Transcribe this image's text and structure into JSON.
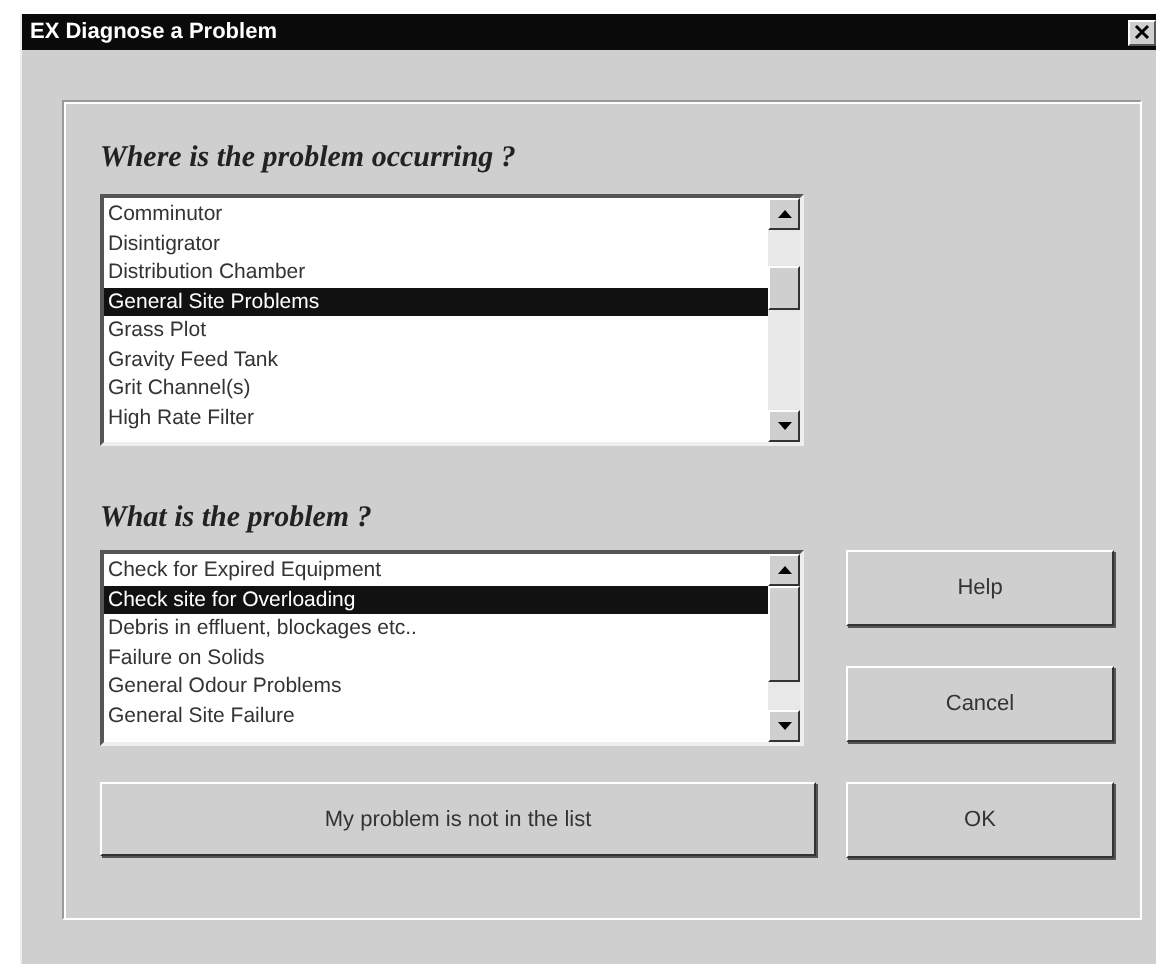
{
  "window": {
    "title": "EX Diagnose a Problem"
  },
  "location": {
    "heading": "Where is the problem occurring ?",
    "items": [
      {
        "label": "Comminutor",
        "selected": false
      },
      {
        "label": "Disintigrator",
        "selected": false
      },
      {
        "label": "Distribution Chamber",
        "selected": false
      },
      {
        "label": "General Site Problems",
        "selected": true
      },
      {
        "label": "Grass Plot",
        "selected": false
      },
      {
        "label": "Gravity Feed Tank",
        "selected": false
      },
      {
        "label": "Grit Channel(s)",
        "selected": false
      },
      {
        "label": "High Rate Filter",
        "selected": false
      }
    ]
  },
  "problem": {
    "heading": "What is the problem ?",
    "items": [
      {
        "label": "Check for Expired Equipment",
        "selected": false
      },
      {
        "label": "Check site for Overloading",
        "selected": true
      },
      {
        "label": "Debris in effluent, blockages etc..",
        "selected": false
      },
      {
        "label": "Failure on Solids",
        "selected": false
      },
      {
        "label": "General Odour Problems",
        "selected": false
      },
      {
        "label": "General Site Failure",
        "selected": false
      }
    ]
  },
  "buttons": {
    "help": "Help",
    "cancel": "Cancel",
    "not_listed": "My problem is not in the list",
    "ok": "OK"
  }
}
